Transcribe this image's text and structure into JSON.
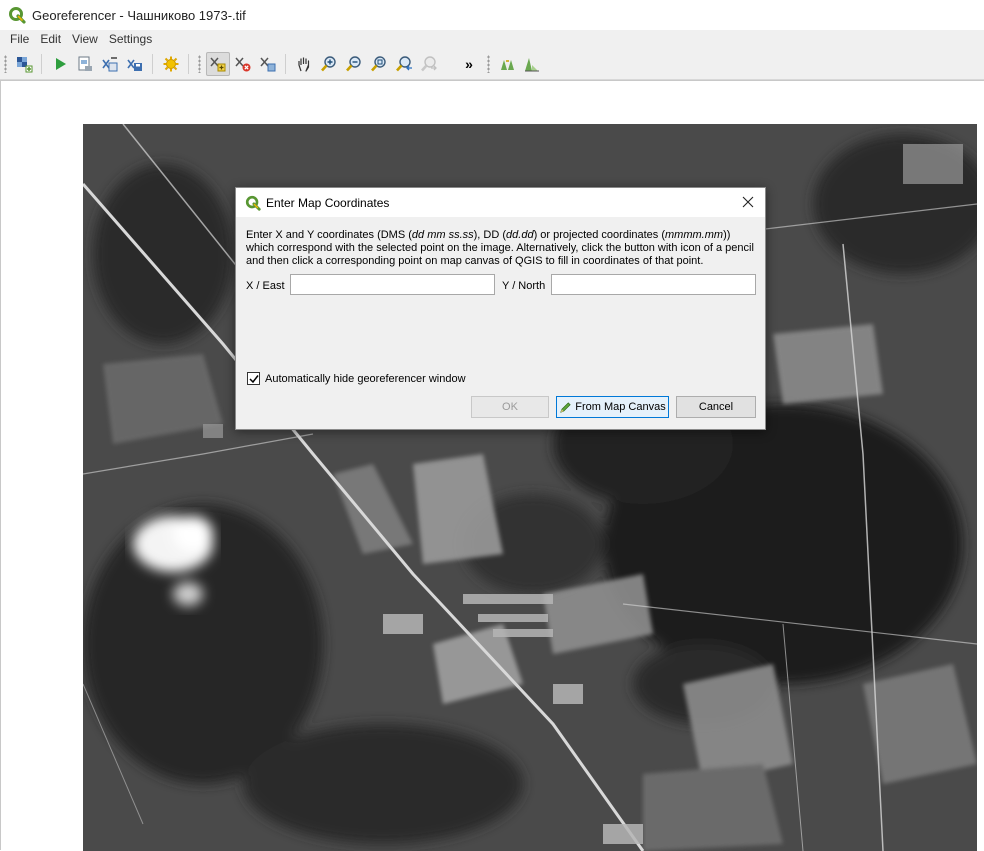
{
  "window": {
    "title": "Georeferencer - Чашниково 1973-.tif",
    "logo_icon": "qgis-logo-icon",
    "accent_color": "#589632"
  },
  "menubar": {
    "items": [
      "File",
      "Edit",
      "View",
      "Settings"
    ]
  },
  "toolbar": {
    "more_label": "»",
    "buttons": [
      {
        "icon": "open-raster-icon"
      },
      {
        "icon": "start-georeferencing-icon"
      },
      {
        "icon": "generate-gdal-script-icon"
      },
      {
        "icon": "load-gcp-points-icon"
      },
      {
        "icon": "save-gcp-points-icon"
      },
      {
        "icon": "transformation-settings-icon"
      },
      {
        "icon": "add-point-icon",
        "active": true
      },
      {
        "icon": "delete-point-icon"
      },
      {
        "icon": "move-gcp-point-icon"
      },
      {
        "icon": "pan-icon"
      },
      {
        "icon": "zoom-in-icon"
      },
      {
        "icon": "zoom-out-icon"
      },
      {
        "icon": "zoom-to-layer-icon"
      },
      {
        "icon": "zoom-last-icon"
      },
      {
        "icon": "zoom-next-icon"
      },
      {
        "icon": "link-georeferencer-to-qgis-icon"
      },
      {
        "icon": "histogram-stretch-icon"
      }
    ]
  },
  "dialog": {
    "title": "Enter Map Coordinates",
    "description": {
      "p1": "Enter X and Y coordinates (DMS (",
      "dms_format": "dd mm ss.ss",
      "p2": "), DD (",
      "dd_format": "dd.dd",
      "p3": ") or projected coordinates (",
      "proj_format": "mmmm.mm",
      "p4": ")) which correspond with the selected point on the image. Alternatively, click the button with icon of a pencil and then click a corresponding point on map canvas of QGIS to fill in coordinates of that point."
    },
    "x_label": "X / East",
    "x_value": "",
    "y_label": "Y / North",
    "y_value": "",
    "auto_hide_label": "Automatically hide georeferencer window",
    "auto_hide_checked": true,
    "ok_label": "OK",
    "from_canvas_label": "From Map Canvas",
    "cancel_label": "Cancel"
  }
}
